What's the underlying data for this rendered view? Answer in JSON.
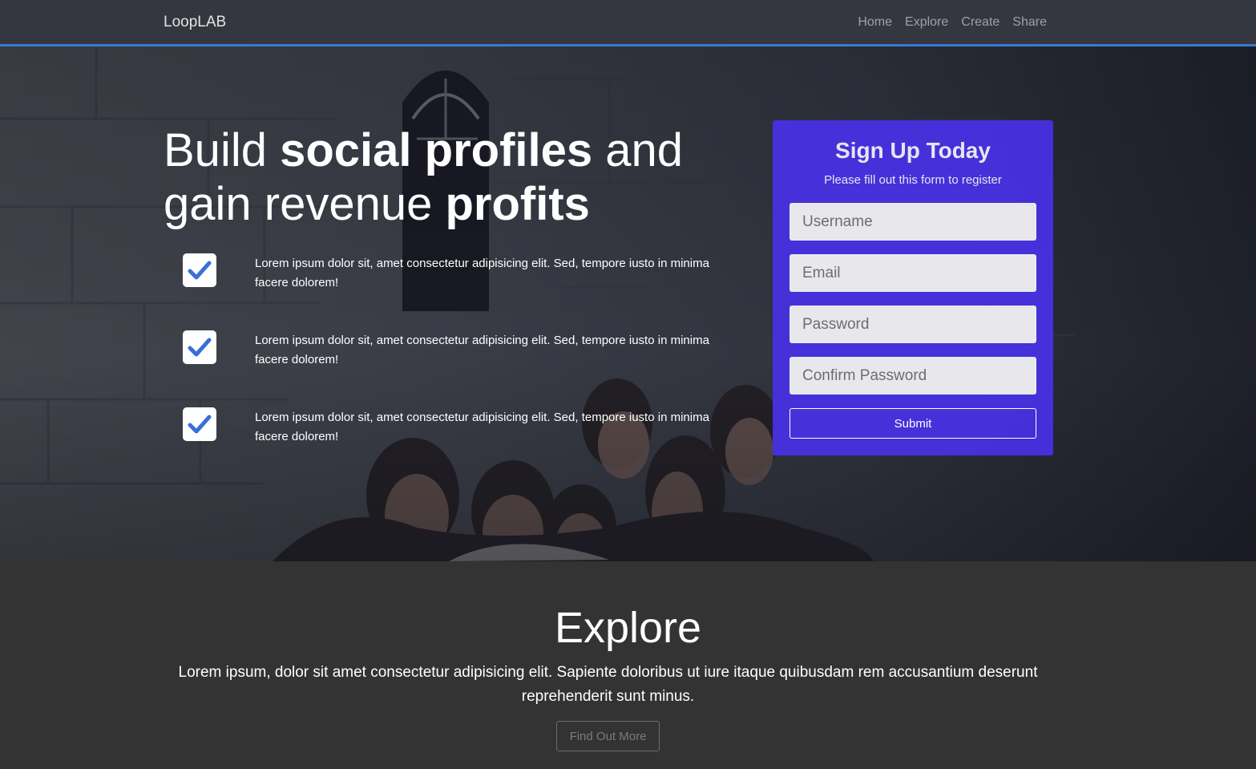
{
  "navbar": {
    "brand": "LoopLAB",
    "links": [
      "Home",
      "Explore",
      "Create",
      "Share"
    ]
  },
  "hero": {
    "title_parts": [
      "Build ",
      "social profiles",
      " and gain revenue ",
      "profits"
    ],
    "features": [
      "Lorem ipsum dolor sit, amet consectetur adipisicing elit. Sed, tempore iusto in minima facere dolorem!",
      "Lorem ipsum dolor sit, amet consectetur adipisicing elit. Sed, tempore iusto in minima facere dolorem!",
      "Lorem ipsum dolor sit, amet consectetur adipisicing elit. Sed, tempore iusto in minima facere dolorem!"
    ]
  },
  "signup": {
    "title": "Sign Up Today",
    "subtitle": "Please fill out this form to register",
    "fields": [
      {
        "placeholder": "Username",
        "value": ""
      },
      {
        "placeholder": "Email",
        "value": ""
      },
      {
        "placeholder": "Password",
        "value": ""
      },
      {
        "placeholder": "Confirm Password",
        "value": ""
      }
    ],
    "submit_label": "Submit"
  },
  "explore": {
    "title": "Explore",
    "text": "Lorem ipsum, dolor sit amet consectetur adipisicing elit. Sapiente doloribus ut iure itaque quibusdam rem accusantium deserunt reprehenderit sunt minus.",
    "button_label": "Find Out More"
  },
  "colors": {
    "navbar_bg": "#34373f",
    "navbar_border": "#3a78d6",
    "signup_bg": "#4830e6",
    "checkmark": "#3a6fd8",
    "explore_bg": "#333333"
  },
  "icons": {
    "feature_check": "check-box-icon"
  }
}
